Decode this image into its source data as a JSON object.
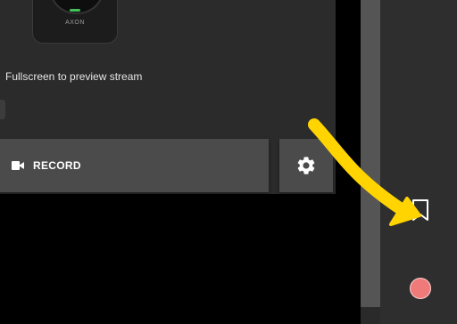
{
  "camera": {
    "brand": "AXON"
  },
  "stream_hint": "Fullscreen to preview stream",
  "record_button": {
    "label": "RECORD",
    "icon": "videocam-icon"
  },
  "settings_button": {
    "icon": "gear-icon"
  },
  "side_panel": {
    "bookmark_icon": "bookmark-icon",
    "record_icon": "record-dot-icon"
  },
  "annotation": {
    "type": "curved-arrow",
    "color": "#FFD400"
  },
  "colors": {
    "panel": "#2b2b2b",
    "button": "#4b4b4b",
    "record_dot": "#f07a7a",
    "arrow": "#FFD400"
  }
}
